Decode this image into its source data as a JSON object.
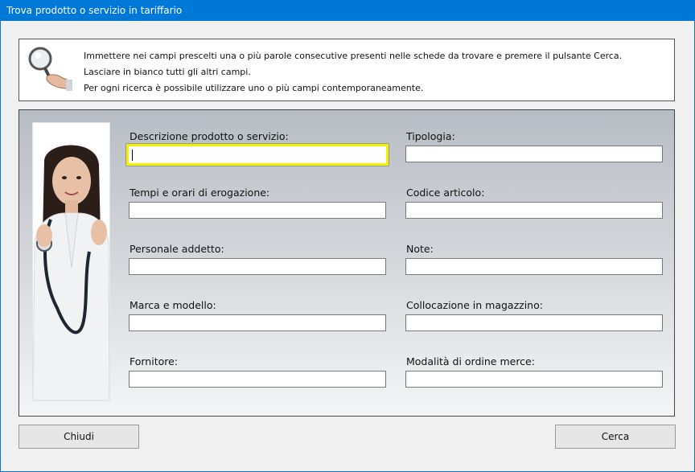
{
  "window": {
    "title": "Trova prodotto o servizio in tariffario"
  },
  "info": {
    "lines": [
      "Immettere nei campi prescelti una o più parole consecutive presenti nelle schede da trovare e premere il pulsante Cerca.",
      "Lasciare in bianco tutti gli altri campi.",
      "Per ogni ricerca è possibile utilizzare uno o più campi contemporaneamente."
    ]
  },
  "fields": {
    "descrizione": {
      "label": "Descrizione prodotto o servizio:",
      "value": ""
    },
    "tipologia": {
      "label": "Tipologia:",
      "value": ""
    },
    "tempi": {
      "label": "Tempi e orari di erogazione:",
      "value": ""
    },
    "codice": {
      "label": "Codice articolo:",
      "value": ""
    },
    "personale": {
      "label": "Personale addetto:",
      "value": ""
    },
    "note": {
      "label": "Note:",
      "value": ""
    },
    "marca": {
      "label": "Marca e modello:",
      "value": ""
    },
    "collocazione": {
      "label": "Collocazione in magazzino:",
      "value": ""
    },
    "fornitore": {
      "label": "Fornitore:",
      "value": ""
    },
    "modalita": {
      "label": "Modalità di ordine merce:",
      "value": ""
    }
  },
  "buttons": {
    "close": "Chiudi",
    "search": "Cerca"
  },
  "colors": {
    "titlebar": "#0078d7",
    "focus_highlight": "#f2f200"
  },
  "icons": {
    "info": "magnifier-hand-icon"
  }
}
